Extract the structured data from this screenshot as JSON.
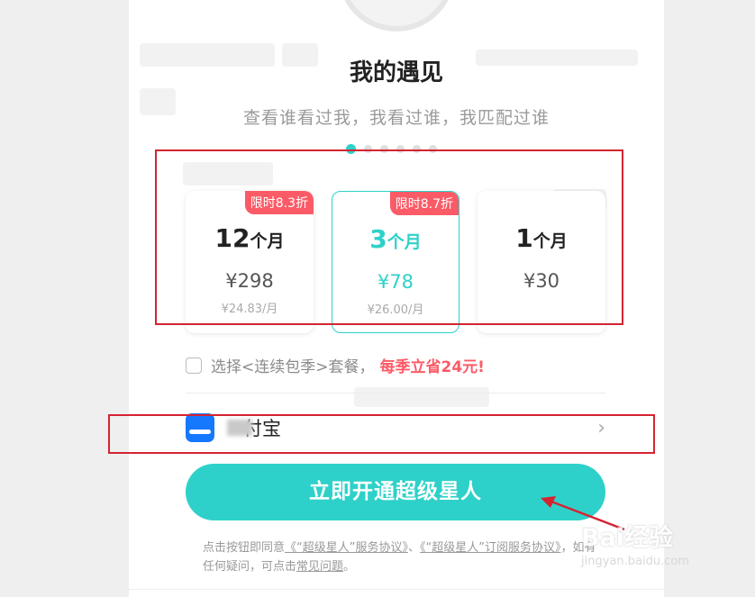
{
  "feature": {
    "title": "我的遇见",
    "subtitle": "查看谁看过我，我看过谁，我匹配过谁",
    "page_count": 6,
    "active_page": 1
  },
  "plans": [
    {
      "badge": "限时8.3折",
      "num": "12",
      "unit": "个月",
      "price": "¥298",
      "per_month": "¥24.83/月",
      "selected": false
    },
    {
      "badge": "限时8.7折",
      "num": "3",
      "unit": "个月",
      "price": "¥78",
      "per_month": "¥26.00/月",
      "selected": true
    },
    {
      "badge": "",
      "num": "1",
      "unit": "个月",
      "price": "¥30",
      "per_month": "",
      "selected": false
    }
  ],
  "renew": {
    "text": "选择<连续包季>套餐，",
    "highlight": "每季立省24元!",
    "checked": false
  },
  "payment": {
    "icon": "alipay-icon",
    "label": "付宝",
    "chevron": "›"
  },
  "cta": {
    "label": "立即开通超级星人"
  },
  "agreement": {
    "prefix": "点击按钮即同意",
    "link1": "《“超级星人”服务协议》",
    "sep": "、",
    "link2": "《“超级星人”订阅服务协议》",
    "middle": "，如有任何疑问，可点击",
    "link3": "常见问题",
    "suffix": "。"
  },
  "colors": {
    "accent": "#2ed1c9",
    "badge": "#fb5b67",
    "annotation": "#d42432"
  },
  "watermark": {
    "main": "Bai经验",
    "sub": "jingyan.baidu.com"
  }
}
